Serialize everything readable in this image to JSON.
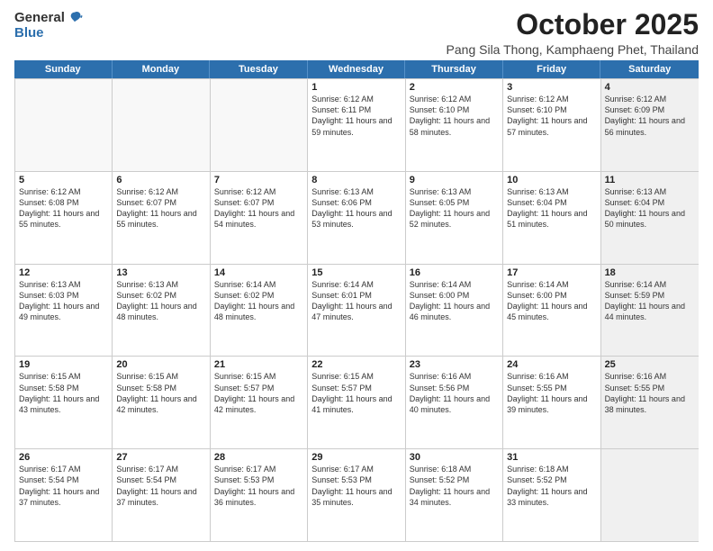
{
  "header": {
    "logo_general": "General",
    "logo_blue": "Blue",
    "month_title": "October 2025",
    "location": "Pang Sila Thong, Kamphaeng Phet, Thailand"
  },
  "weekdays": [
    "Sunday",
    "Monday",
    "Tuesday",
    "Wednesday",
    "Thursday",
    "Friday",
    "Saturday"
  ],
  "rows": [
    [
      {
        "day": "",
        "empty": true
      },
      {
        "day": "",
        "empty": true
      },
      {
        "day": "",
        "empty": true
      },
      {
        "day": "1",
        "sunrise": "6:12 AM",
        "sunset": "6:11 PM",
        "daylight": "11 hours and 59 minutes."
      },
      {
        "day": "2",
        "sunrise": "6:12 AM",
        "sunset": "6:10 PM",
        "daylight": "11 hours and 58 minutes."
      },
      {
        "day": "3",
        "sunrise": "6:12 AM",
        "sunset": "6:10 PM",
        "daylight": "11 hours and 57 minutes."
      },
      {
        "day": "4",
        "sunrise": "6:12 AM",
        "sunset": "6:09 PM",
        "daylight": "11 hours and 56 minutes.",
        "shaded": true
      }
    ],
    [
      {
        "day": "5",
        "sunrise": "6:12 AM",
        "sunset": "6:08 PM",
        "daylight": "11 hours and 55 minutes."
      },
      {
        "day": "6",
        "sunrise": "6:12 AM",
        "sunset": "6:07 PM",
        "daylight": "11 hours and 55 minutes."
      },
      {
        "day": "7",
        "sunrise": "6:12 AM",
        "sunset": "6:07 PM",
        "daylight": "11 hours and 54 minutes."
      },
      {
        "day": "8",
        "sunrise": "6:13 AM",
        "sunset": "6:06 PM",
        "daylight": "11 hours and 53 minutes."
      },
      {
        "day": "9",
        "sunrise": "6:13 AM",
        "sunset": "6:05 PM",
        "daylight": "11 hours and 52 minutes."
      },
      {
        "day": "10",
        "sunrise": "6:13 AM",
        "sunset": "6:04 PM",
        "daylight": "11 hours and 51 minutes."
      },
      {
        "day": "11",
        "sunrise": "6:13 AM",
        "sunset": "6:04 PM",
        "daylight": "11 hours and 50 minutes.",
        "shaded": true
      }
    ],
    [
      {
        "day": "12",
        "sunrise": "6:13 AM",
        "sunset": "6:03 PM",
        "daylight": "11 hours and 49 minutes."
      },
      {
        "day": "13",
        "sunrise": "6:13 AM",
        "sunset": "6:02 PM",
        "daylight": "11 hours and 48 minutes."
      },
      {
        "day": "14",
        "sunrise": "6:14 AM",
        "sunset": "6:02 PM",
        "daylight": "11 hours and 48 minutes."
      },
      {
        "day": "15",
        "sunrise": "6:14 AM",
        "sunset": "6:01 PM",
        "daylight": "11 hours and 47 minutes."
      },
      {
        "day": "16",
        "sunrise": "6:14 AM",
        "sunset": "6:00 PM",
        "daylight": "11 hours and 46 minutes."
      },
      {
        "day": "17",
        "sunrise": "6:14 AM",
        "sunset": "6:00 PM",
        "daylight": "11 hours and 45 minutes."
      },
      {
        "day": "18",
        "sunrise": "6:14 AM",
        "sunset": "5:59 PM",
        "daylight": "11 hours and 44 minutes.",
        "shaded": true
      }
    ],
    [
      {
        "day": "19",
        "sunrise": "6:15 AM",
        "sunset": "5:58 PM",
        "daylight": "11 hours and 43 minutes."
      },
      {
        "day": "20",
        "sunrise": "6:15 AM",
        "sunset": "5:58 PM",
        "daylight": "11 hours and 42 minutes."
      },
      {
        "day": "21",
        "sunrise": "6:15 AM",
        "sunset": "5:57 PM",
        "daylight": "11 hours and 42 minutes."
      },
      {
        "day": "22",
        "sunrise": "6:15 AM",
        "sunset": "5:57 PM",
        "daylight": "11 hours and 41 minutes."
      },
      {
        "day": "23",
        "sunrise": "6:16 AM",
        "sunset": "5:56 PM",
        "daylight": "11 hours and 40 minutes."
      },
      {
        "day": "24",
        "sunrise": "6:16 AM",
        "sunset": "5:55 PM",
        "daylight": "11 hours and 39 minutes."
      },
      {
        "day": "25",
        "sunrise": "6:16 AM",
        "sunset": "5:55 PM",
        "daylight": "11 hours and 38 minutes.",
        "shaded": true
      }
    ],
    [
      {
        "day": "26",
        "sunrise": "6:17 AM",
        "sunset": "5:54 PM",
        "daylight": "11 hours and 37 minutes."
      },
      {
        "day": "27",
        "sunrise": "6:17 AM",
        "sunset": "5:54 PM",
        "daylight": "11 hours and 37 minutes."
      },
      {
        "day": "28",
        "sunrise": "6:17 AM",
        "sunset": "5:53 PM",
        "daylight": "11 hours and 36 minutes."
      },
      {
        "day": "29",
        "sunrise": "6:17 AM",
        "sunset": "5:53 PM",
        "daylight": "11 hours and 35 minutes."
      },
      {
        "day": "30",
        "sunrise": "6:18 AM",
        "sunset": "5:52 PM",
        "daylight": "11 hours and 34 minutes."
      },
      {
        "day": "31",
        "sunrise": "6:18 AM",
        "sunset": "5:52 PM",
        "daylight": "11 hours and 33 minutes."
      },
      {
        "day": "",
        "empty": true,
        "shaded": true
      }
    ]
  ]
}
